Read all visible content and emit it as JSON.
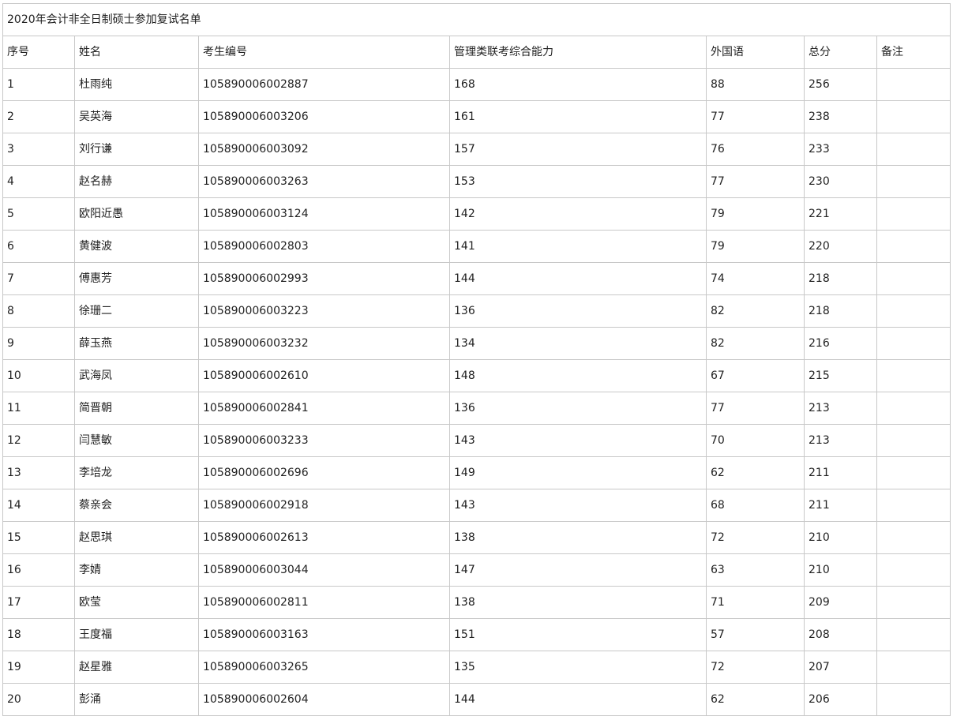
{
  "title": "2020年会计非全日制硕士参加复试名单",
  "headers": [
    "序号",
    "姓名",
    "考生编号",
    "管理类联考综合能力",
    "外国语",
    "总分",
    "备注"
  ],
  "rows": [
    [
      "1",
      "杜雨纯",
      "105890006002887",
      "168",
      "88",
      "256",
      ""
    ],
    [
      "2",
      "吴英海",
      "105890006003206",
      "161",
      "77",
      "238",
      ""
    ],
    [
      "3",
      "刘行谦",
      "105890006003092",
      "157",
      "76",
      "233",
      ""
    ],
    [
      "4",
      "赵名赫",
      "105890006003263",
      "153",
      "77",
      "230",
      ""
    ],
    [
      "5",
      "欧阳近愚",
      "105890006003124",
      "142",
      "79",
      "221",
      ""
    ],
    [
      "6",
      "黄健波",
      "105890006002803",
      "141",
      "79",
      "220",
      ""
    ],
    [
      "7",
      "傅惠芳",
      "105890006002993",
      "144",
      "74",
      "218",
      ""
    ],
    [
      "8",
      "徐珊二",
      "105890006003223",
      "136",
      "82",
      "218",
      ""
    ],
    [
      "9",
      "薛玉燕",
      "105890006003232",
      "134",
      "82",
      "216",
      ""
    ],
    [
      "10",
      "武海凤",
      "105890006002610",
      "148",
      "67",
      "215",
      ""
    ],
    [
      "11",
      "简晋朝",
      "105890006002841",
      "136",
      "77",
      "213",
      ""
    ],
    [
      "12",
      "闫慧敏",
      "105890006003233",
      "143",
      "70",
      "213",
      ""
    ],
    [
      "13",
      "李培龙",
      "105890006002696",
      "149",
      "62",
      "211",
      ""
    ],
    [
      "14",
      "蔡亲会",
      "105890006002918",
      "143",
      "68",
      "211",
      ""
    ],
    [
      "15",
      "赵思琪",
      "105890006002613",
      "138",
      "72",
      "210",
      ""
    ],
    [
      "16",
      "李婧",
      "105890006003044",
      "147",
      "63",
      "210",
      ""
    ],
    [
      "17",
      "欧莹",
      "105890006002811",
      "138",
      "71",
      "209",
      ""
    ],
    [
      "18",
      "王度福",
      "105890006003163",
      "151",
      "57",
      "208",
      ""
    ],
    [
      "19",
      "赵星雅",
      "105890006003265",
      "135",
      "72",
      "207",
      ""
    ],
    [
      "20",
      "彭涌",
      "105890006002604",
      "144",
      "62",
      "206",
      ""
    ]
  ]
}
